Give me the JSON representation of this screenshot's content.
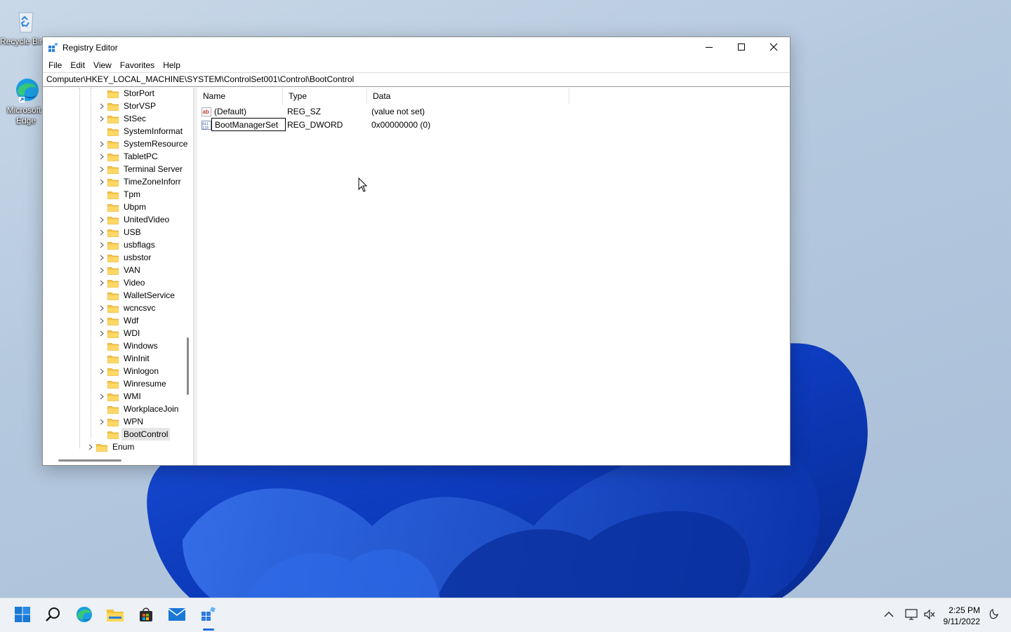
{
  "desktop": {
    "icons": [
      {
        "label": "Recycle Bin",
        "icon": "recycle-bin-icon"
      },
      {
        "label_line1": "Microsoft",
        "label_line2": "Edge",
        "icon": "edge-icon"
      }
    ]
  },
  "window": {
    "title": "Registry Editor",
    "menu": [
      "File",
      "Edit",
      "View",
      "Favorites",
      "Help"
    ],
    "address": "Computer\\HKEY_LOCAL_MACHINE\\SYSTEM\\ControlSet001\\Control\\BootControl",
    "controls": {
      "minimize": "minimize-icon",
      "maximize": "maximize-icon",
      "close": "close-icon"
    }
  },
  "tree": {
    "items": [
      {
        "label": "StorPort",
        "expandable": false
      },
      {
        "label": "StorVSP",
        "expandable": true
      },
      {
        "label": "StSec",
        "expandable": true
      },
      {
        "label": "SystemInformat",
        "expandable": false
      },
      {
        "label": "SystemResource",
        "expandable": true
      },
      {
        "label": "TabletPC",
        "expandable": true
      },
      {
        "label": "Terminal Server",
        "expandable": true
      },
      {
        "label": "TimeZoneInforr",
        "expandable": true
      },
      {
        "label": "Tpm",
        "expandable": false
      },
      {
        "label": "Ubpm",
        "expandable": false
      },
      {
        "label": "UnitedVideo",
        "expandable": true
      },
      {
        "label": "USB",
        "expandable": true
      },
      {
        "label": "usbflags",
        "expandable": true
      },
      {
        "label": "usbstor",
        "expandable": true
      },
      {
        "label": "VAN",
        "expandable": true
      },
      {
        "label": "Video",
        "expandable": true
      },
      {
        "label": "WalletService",
        "expandable": false
      },
      {
        "label": "wcncsvc",
        "expandable": true
      },
      {
        "label": "Wdf",
        "expandable": true
      },
      {
        "label": "WDI",
        "expandable": true
      },
      {
        "label": "Windows",
        "expandable": false
      },
      {
        "label": "WinInit",
        "expandable": false
      },
      {
        "label": "Winlogon",
        "expandable": true
      },
      {
        "label": "Winresume",
        "expandable": false
      },
      {
        "label": "WMI",
        "expandable": true
      },
      {
        "label": "WorkplaceJoin",
        "expandable": false
      },
      {
        "label": "WPN",
        "expandable": true
      },
      {
        "label": "BootControl",
        "expandable": false,
        "selected": true
      },
      {
        "label": "Enum",
        "expandable": true,
        "parent_level": true
      }
    ]
  },
  "list": {
    "columns": [
      "Name",
      "Type",
      "Data"
    ],
    "rows": [
      {
        "name": "(Default)",
        "type": "REG_SZ",
        "data": "(value not set)",
        "icon": "string-value-icon"
      },
      {
        "name": "BootManagerSet",
        "type": "REG_DWORD",
        "data": "0x00000000 (0)",
        "icon": "dword-value-icon",
        "editing": true
      }
    ]
  },
  "taskbar": {
    "apps": [
      "start-icon",
      "search-icon",
      "edge-icon",
      "file-explorer-icon",
      "store-icon",
      "mail-icon",
      "registry-editor-icon"
    ],
    "tray": [
      "chevron-up-icon",
      "network-icon",
      "volume-muted-icon",
      "notifications-icon"
    ],
    "time": "2:25 PM",
    "date": "9/11/2022"
  }
}
